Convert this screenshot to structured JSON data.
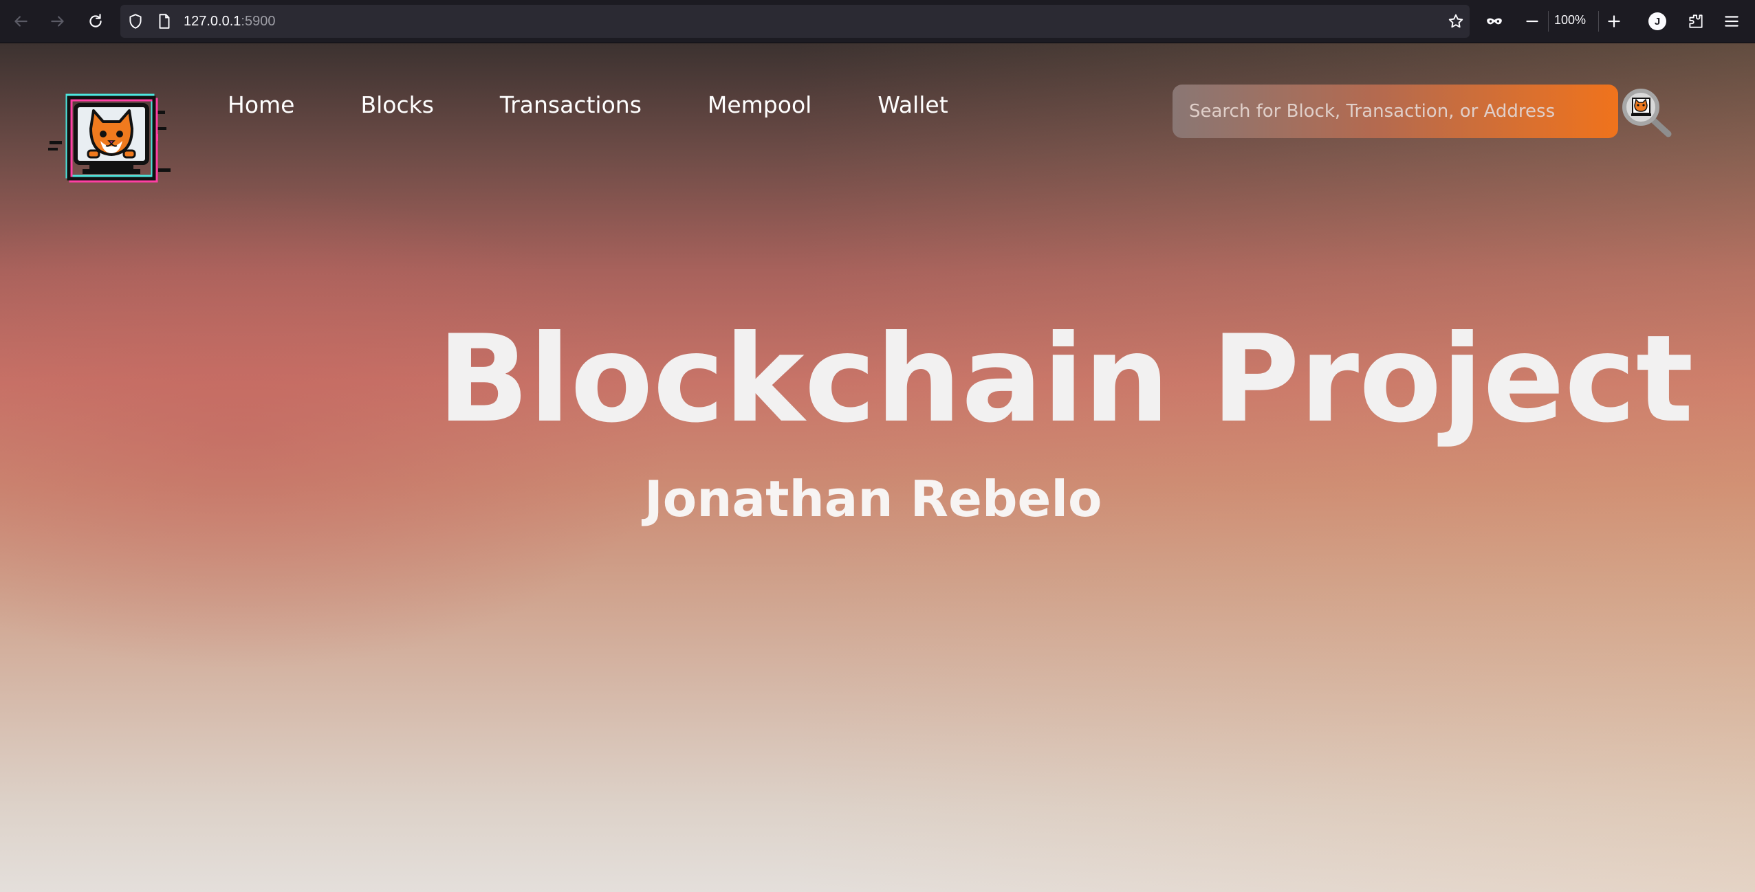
{
  "browser": {
    "url_host": "127.0.0.1",
    "url_port": ":5900",
    "zoom": "100%",
    "profile_initial": "J",
    "icons": [
      "back-arrow-icon",
      "forward-arrow-icon",
      "reload-icon",
      "shield-icon",
      "page-icon",
      "bookmark-star-icon",
      "private-mask-icon",
      "zoom-out-icon",
      "zoom-in-icon",
      "profile-avatar-icon",
      "extensions-icon",
      "menu-icon"
    ]
  },
  "nav": {
    "items": [
      {
        "label": "Home"
      },
      {
        "label": "Blocks"
      },
      {
        "label": "Transactions"
      },
      {
        "label": "Mempool"
      },
      {
        "label": "Wallet"
      }
    ]
  },
  "search": {
    "placeholder": "Search for Block, Transaction, or Address",
    "value": ""
  },
  "hero": {
    "title": "Blockchain Project",
    "subtitle": "Jonathan Rebelo"
  },
  "colors": {
    "chrome_bg": "#1c1b22",
    "urlbar_bg": "#2b2a33",
    "search_accent": "#f0731c",
    "hero_text": "#f2f1f1"
  }
}
